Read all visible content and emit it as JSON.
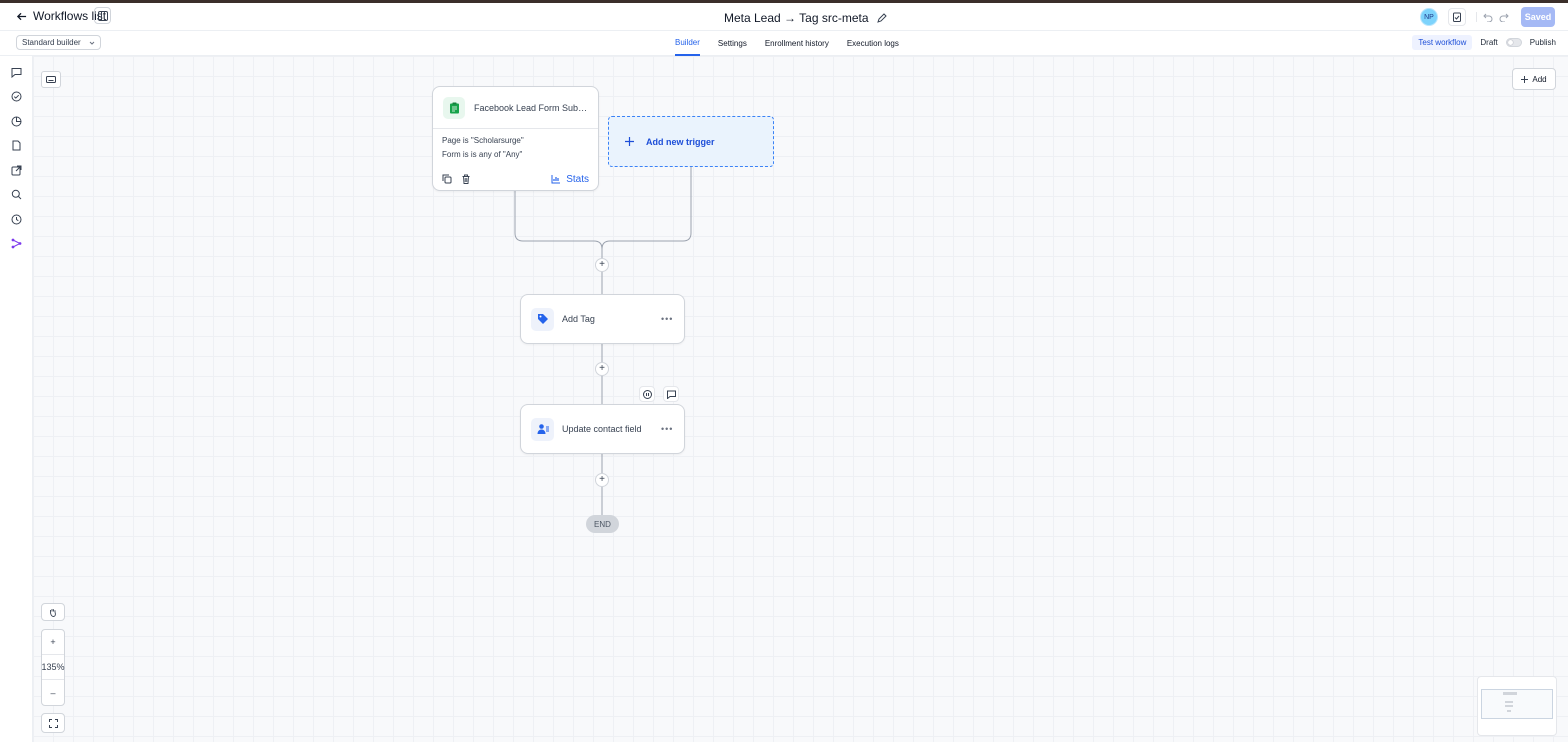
{
  "header": {
    "back_label": "Workflows list",
    "title": "Meta Lead → Tag src-meta",
    "avatar_initials": "NP",
    "saved_label": "Saved"
  },
  "subheader": {
    "builder_mode": "Standard builder",
    "tabs": [
      {
        "label": "Builder",
        "active": true
      },
      {
        "label": "Settings",
        "active": false
      },
      {
        "label": "Enrollment history",
        "active": false
      },
      {
        "label": "Execution logs",
        "active": false
      }
    ],
    "test_workflow_label": "Test workflow",
    "draft_label": "Draft",
    "publish_label": "Publish"
  },
  "rail_icons": [
    "chat-icon",
    "check-circle-icon",
    "pie-chart-icon",
    "document-icon",
    "external-link-icon",
    "search-icon",
    "history-icon",
    "workflow-icon"
  ],
  "canvas": {
    "add_label": "Add",
    "trigger": {
      "title": "Facebook Lead Form Submi...",
      "conditions": [
        "Page is \"Scholarsurge\"",
        "Form is is any of \"Any\""
      ],
      "stats_label": "Stats"
    },
    "new_trigger_label": "Add new trigger",
    "actions": [
      {
        "label": "Add Tag",
        "icon": "tag-icon"
      },
      {
        "label": "Update contact field",
        "icon": "contact-field-icon"
      }
    ],
    "end_label": "END"
  },
  "zoom": {
    "level": "135%"
  },
  "colors": {
    "accent": "#2563eb",
    "saved_button": "#a5b9f5",
    "trigger_icon_bg": "#e8f7ee",
    "new_trigger_bg": "#eaf3fd"
  }
}
